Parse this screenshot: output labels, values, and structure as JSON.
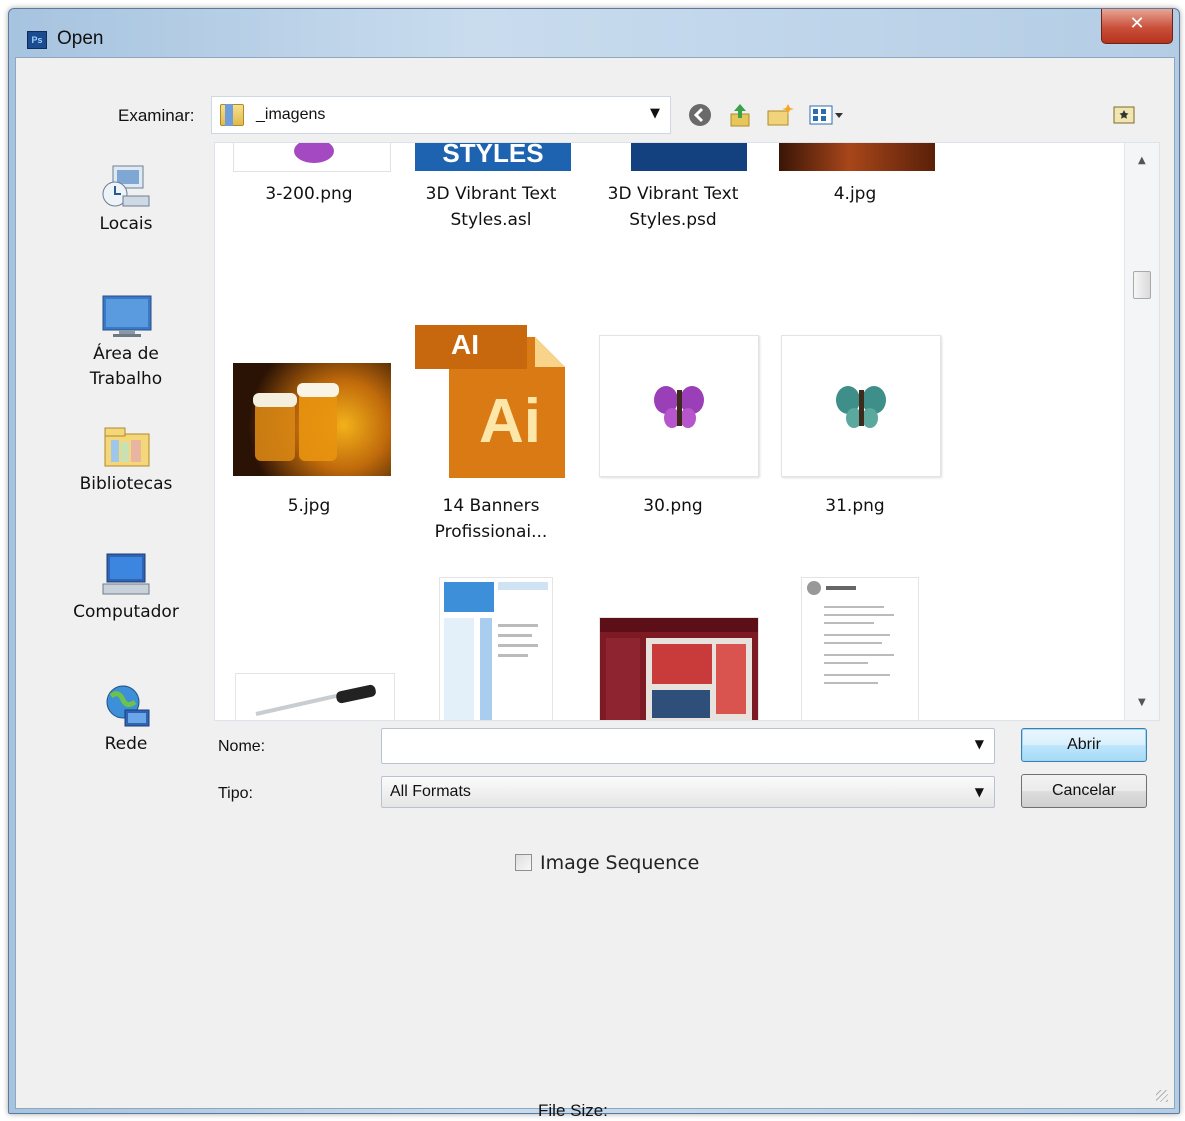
{
  "window": {
    "title": "Open",
    "app_icon_text": "Ps",
    "close_symbol": "✕"
  },
  "look_in": {
    "label": "Examinar:",
    "value": "_imagens",
    "icons": [
      "back-icon",
      "up-folder-icon",
      "new-folder-icon",
      "view-menu-icon",
      "bridge-icon"
    ]
  },
  "places": [
    {
      "label": "Locais",
      "icon": "recent-places-icon"
    },
    {
      "label": "Área de\nTrabalho",
      "icon": "desktop-icon"
    },
    {
      "label": "Bibliotecas",
      "icon": "libraries-icon"
    },
    {
      "label": "Computador",
      "icon": "computer-icon"
    },
    {
      "label": "Rede",
      "icon": "network-icon"
    }
  ],
  "files": [
    {
      "name": "3-200.png"
    },
    {
      "name": "3D Vibrant Text Styles.asl",
      "thumb_text": "STYLES"
    },
    {
      "name": "3D Vibrant Text Styles.psd"
    },
    {
      "name": "4.jpg"
    },
    {
      "name": "5.jpg"
    },
    {
      "name": "14 Banners Profissionai...",
      "thumb_text_top": "AI",
      "thumb_text_main": "Ai"
    },
    {
      "name": "30.png"
    },
    {
      "name": "31.png"
    },
    {
      "name": ""
    },
    {
      "name": ""
    },
    {
      "name": ""
    },
    {
      "name": ""
    }
  ],
  "form": {
    "name_label": "Nome:",
    "name_value": "",
    "type_label": "Tipo:",
    "type_value": "All Formats",
    "open_button": "Abrir",
    "cancel_button": "Cancelar",
    "image_sequence_label": "Image Sequence",
    "image_sequence_checked": false,
    "file_size_label": "File Size:"
  },
  "colors": {
    "titlebar": "#b4cde5",
    "close_button": "#c9503a",
    "default_button": "#bee6fd"
  }
}
